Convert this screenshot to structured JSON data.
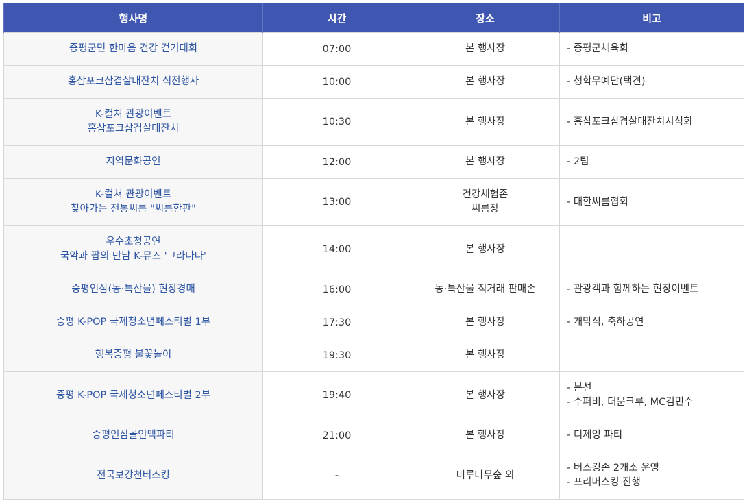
{
  "header": {
    "event": "행사명",
    "time": "시간",
    "place": "장소",
    "note": "비고"
  },
  "rows": [
    {
      "name": [
        "증평군민 한마음 건강 걷기대회"
      ],
      "time": "07:00",
      "place": [
        "본 행사장"
      ],
      "note": [
        "- 증평군체육회"
      ]
    },
    {
      "name": [
        "홍삼포크삼겹살대잔치 식전행사"
      ],
      "time": "10:00",
      "place": [
        "본 행사장"
      ],
      "note": [
        "- 청학무예단(택견)"
      ]
    },
    {
      "name": [
        "K-컬쳐 관광이벤트",
        "홍삼포크삼겹살대잔치"
      ],
      "time": "10:30",
      "place": [
        "본 행사장"
      ],
      "note": [
        "- 홍삼포크삼겹살대잔치시식회"
      ]
    },
    {
      "name": [
        "지역문화공연"
      ],
      "time": "12:00",
      "place": [
        "본 행사장"
      ],
      "note": [
        "- 2팀"
      ]
    },
    {
      "name": [
        "K-컬쳐 관광이벤트",
        "찾아가는 전통씨름 \"씨름한판\""
      ],
      "time": "13:00",
      "place": [
        "건강체험존",
        "씨름장"
      ],
      "note": [
        "- 대한씨름협회"
      ]
    },
    {
      "name": [
        "우수초청공연",
        "국악과 팝의 만남 K-뮤즈 '그라나다'"
      ],
      "time": "14:00",
      "place": [
        "본 행사장"
      ],
      "note": []
    },
    {
      "name": [
        "증평인삼(농·특산물) 현장경매"
      ],
      "time": "16:00",
      "place": [
        "농·특산물 직거래 판매존"
      ],
      "note": [
        "- 관광객과 함께하는 현장이벤트"
      ]
    },
    {
      "name": [
        "증평 K-POP 국제청소년페스티벌 1부"
      ],
      "time": "17:30",
      "place": [
        "본 행사장"
      ],
      "note": [
        "- 개막식, 축하공연"
      ]
    },
    {
      "name": [
        "행복증평 불꽃놀이"
      ],
      "time": "19:30",
      "place": [
        "본 행사장"
      ],
      "note": []
    },
    {
      "name": [
        "증평 K-POP 국제청소년페스티벌 2부"
      ],
      "time": "19:40",
      "place": [
        "본 행사장"
      ],
      "note": [
        "- 본선",
        "- 수퍼비, 더문크루, MC김민수"
      ]
    },
    {
      "name": [
        "증평인삼골인맥파티"
      ],
      "time": "21:00",
      "place": [
        "본 행사장"
      ],
      "note": [
        "- 디제잉 파티"
      ]
    },
    {
      "name": [
        "전국보강천버스킹"
      ],
      "time": "-",
      "place": [
        "미루나무숲 외"
      ],
      "note": [
        "- 버스킹존 2개소 운영",
        "- 프리버스킹 진행"
      ]
    }
  ]
}
